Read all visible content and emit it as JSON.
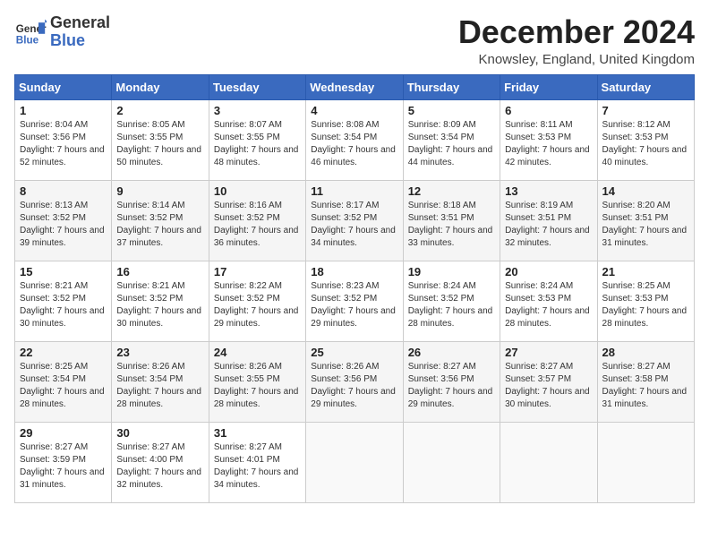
{
  "logo": {
    "line1": "General",
    "line2": "Blue"
  },
  "title": "December 2024",
  "subtitle": "Knowsley, England, United Kingdom",
  "days_header": [
    "Sunday",
    "Monday",
    "Tuesday",
    "Wednesday",
    "Thursday",
    "Friday",
    "Saturday"
  ],
  "weeks": [
    [
      {
        "day": "1",
        "sunrise": "Sunrise: 8:04 AM",
        "sunset": "Sunset: 3:56 PM",
        "daylight": "Daylight: 7 hours and 52 minutes."
      },
      {
        "day": "2",
        "sunrise": "Sunrise: 8:05 AM",
        "sunset": "Sunset: 3:55 PM",
        "daylight": "Daylight: 7 hours and 50 minutes."
      },
      {
        "day": "3",
        "sunrise": "Sunrise: 8:07 AM",
        "sunset": "Sunset: 3:55 PM",
        "daylight": "Daylight: 7 hours and 48 minutes."
      },
      {
        "day": "4",
        "sunrise": "Sunrise: 8:08 AM",
        "sunset": "Sunset: 3:54 PM",
        "daylight": "Daylight: 7 hours and 46 minutes."
      },
      {
        "day": "5",
        "sunrise": "Sunrise: 8:09 AM",
        "sunset": "Sunset: 3:54 PM",
        "daylight": "Daylight: 7 hours and 44 minutes."
      },
      {
        "day": "6",
        "sunrise": "Sunrise: 8:11 AM",
        "sunset": "Sunset: 3:53 PM",
        "daylight": "Daylight: 7 hours and 42 minutes."
      },
      {
        "day": "7",
        "sunrise": "Sunrise: 8:12 AM",
        "sunset": "Sunset: 3:53 PM",
        "daylight": "Daylight: 7 hours and 40 minutes."
      }
    ],
    [
      {
        "day": "8",
        "sunrise": "Sunrise: 8:13 AM",
        "sunset": "Sunset: 3:52 PM",
        "daylight": "Daylight: 7 hours and 39 minutes."
      },
      {
        "day": "9",
        "sunrise": "Sunrise: 8:14 AM",
        "sunset": "Sunset: 3:52 PM",
        "daylight": "Daylight: 7 hours and 37 minutes."
      },
      {
        "day": "10",
        "sunrise": "Sunrise: 8:16 AM",
        "sunset": "Sunset: 3:52 PM",
        "daylight": "Daylight: 7 hours and 36 minutes."
      },
      {
        "day": "11",
        "sunrise": "Sunrise: 8:17 AM",
        "sunset": "Sunset: 3:52 PM",
        "daylight": "Daylight: 7 hours and 34 minutes."
      },
      {
        "day": "12",
        "sunrise": "Sunrise: 8:18 AM",
        "sunset": "Sunset: 3:51 PM",
        "daylight": "Daylight: 7 hours and 33 minutes."
      },
      {
        "day": "13",
        "sunrise": "Sunrise: 8:19 AM",
        "sunset": "Sunset: 3:51 PM",
        "daylight": "Daylight: 7 hours and 32 minutes."
      },
      {
        "day": "14",
        "sunrise": "Sunrise: 8:20 AM",
        "sunset": "Sunset: 3:51 PM",
        "daylight": "Daylight: 7 hours and 31 minutes."
      }
    ],
    [
      {
        "day": "15",
        "sunrise": "Sunrise: 8:21 AM",
        "sunset": "Sunset: 3:52 PM",
        "daylight": "Daylight: 7 hours and 30 minutes."
      },
      {
        "day": "16",
        "sunrise": "Sunrise: 8:21 AM",
        "sunset": "Sunset: 3:52 PM",
        "daylight": "Daylight: 7 hours and 30 minutes."
      },
      {
        "day": "17",
        "sunrise": "Sunrise: 8:22 AM",
        "sunset": "Sunset: 3:52 PM",
        "daylight": "Daylight: 7 hours and 29 minutes."
      },
      {
        "day": "18",
        "sunrise": "Sunrise: 8:23 AM",
        "sunset": "Sunset: 3:52 PM",
        "daylight": "Daylight: 7 hours and 29 minutes."
      },
      {
        "day": "19",
        "sunrise": "Sunrise: 8:24 AM",
        "sunset": "Sunset: 3:52 PM",
        "daylight": "Daylight: 7 hours and 28 minutes."
      },
      {
        "day": "20",
        "sunrise": "Sunrise: 8:24 AM",
        "sunset": "Sunset: 3:53 PM",
        "daylight": "Daylight: 7 hours and 28 minutes."
      },
      {
        "day": "21",
        "sunrise": "Sunrise: 8:25 AM",
        "sunset": "Sunset: 3:53 PM",
        "daylight": "Daylight: 7 hours and 28 minutes."
      }
    ],
    [
      {
        "day": "22",
        "sunrise": "Sunrise: 8:25 AM",
        "sunset": "Sunset: 3:54 PM",
        "daylight": "Daylight: 7 hours and 28 minutes."
      },
      {
        "day": "23",
        "sunrise": "Sunrise: 8:26 AM",
        "sunset": "Sunset: 3:54 PM",
        "daylight": "Daylight: 7 hours and 28 minutes."
      },
      {
        "day": "24",
        "sunrise": "Sunrise: 8:26 AM",
        "sunset": "Sunset: 3:55 PM",
        "daylight": "Daylight: 7 hours and 28 minutes."
      },
      {
        "day": "25",
        "sunrise": "Sunrise: 8:26 AM",
        "sunset": "Sunset: 3:56 PM",
        "daylight": "Daylight: 7 hours and 29 minutes."
      },
      {
        "day": "26",
        "sunrise": "Sunrise: 8:27 AM",
        "sunset": "Sunset: 3:56 PM",
        "daylight": "Daylight: 7 hours and 29 minutes."
      },
      {
        "day": "27",
        "sunrise": "Sunrise: 8:27 AM",
        "sunset": "Sunset: 3:57 PM",
        "daylight": "Daylight: 7 hours and 30 minutes."
      },
      {
        "day": "28",
        "sunrise": "Sunrise: 8:27 AM",
        "sunset": "Sunset: 3:58 PM",
        "daylight": "Daylight: 7 hours and 31 minutes."
      }
    ],
    [
      {
        "day": "29",
        "sunrise": "Sunrise: 8:27 AM",
        "sunset": "Sunset: 3:59 PM",
        "daylight": "Daylight: 7 hours and 31 minutes."
      },
      {
        "day": "30",
        "sunrise": "Sunrise: 8:27 AM",
        "sunset": "Sunset: 4:00 PM",
        "daylight": "Daylight: 7 hours and 32 minutes."
      },
      {
        "day": "31",
        "sunrise": "Sunrise: 8:27 AM",
        "sunset": "Sunset: 4:01 PM",
        "daylight": "Daylight: 7 hours and 34 minutes."
      },
      null,
      null,
      null,
      null
    ]
  ]
}
